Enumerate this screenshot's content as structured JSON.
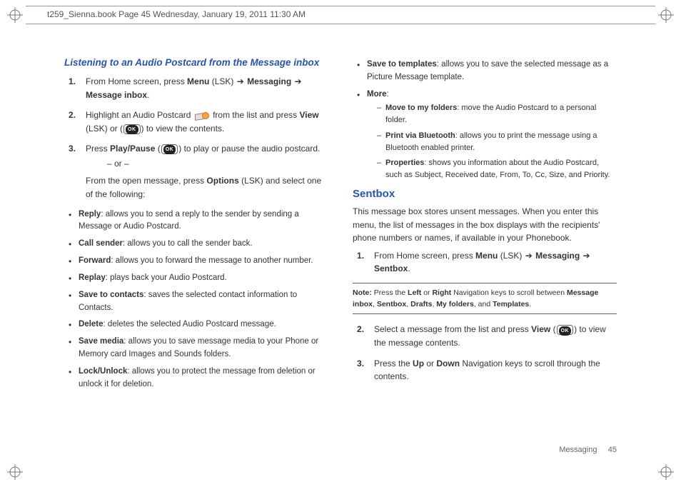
{
  "header": {
    "line": "t259_Sienna.book  Page 45  Wednesday, January 19, 2011  11:30 AM"
  },
  "glyphs": {
    "arrow": "➔",
    "ok": "OK"
  },
  "sect1": {
    "title": "Listening to an Audio Postcard from the Message inbox",
    "steps": {
      "s1": {
        "a": "From Home screen, press ",
        "b": "Menu",
        "c": " (LSK) ",
        "d": " Messaging ",
        "e": " Message inbox",
        "f": "."
      },
      "s2": {
        "a": "Highlight an Audio Postcard ",
        "b": " from the list and press ",
        "c": "View",
        "d": " (LSK) or (",
        "e": ") to view the contents."
      },
      "s3": {
        "a": "Press ",
        "b": "Play/Pause",
        "c": " (",
        "d": ") to play or pause the audio postcard."
      },
      "or": "– or –",
      "s3b": {
        "a": "From the open message, press ",
        "b": "Options",
        "c": " (LSK) and select one of the following:"
      }
    },
    "bul": {
      "reply": {
        "k": "Reply",
        "v": ": allows you to send a reply to the sender by sending a Message or Audio Postcard."
      },
      "call": {
        "k": "Call sender",
        "v": ": allows you to call the sender back."
      },
      "forward": {
        "k": "Forward",
        "v": ": allows you to forward the message to another number."
      },
      "replay": {
        "k": "Replay",
        "v": ": plays back your Audio Postcard."
      },
      "savec": {
        "k": "Save to contacts",
        "v": ": saves the selected contact information to Contacts."
      },
      "delete": {
        "k": "Delete",
        "v": ": deletes the selected Audio Postcard message."
      },
      "savem": {
        "k": "Save media",
        "v": ": allows you to save message media to your Phone or Memory card Images and Sounds folders."
      },
      "lock": {
        "k": "Lock/Unlock",
        "v": ": allows you to protect the message from deletion or unlock it for deletion."
      },
      "savet": {
        "k": "Save to templates",
        "v": ": allows you to save the selected message as a Picture Message template."
      },
      "more": {
        "k": "More",
        "v": ":"
      },
      "more_items": {
        "move": {
          "k": "Move to my folders",
          "v": ": move the Audio Postcard to a personal folder."
        },
        "print": {
          "k": "Print via Bluetooth",
          "v": ": allows you to print the message using a Bluetooth enabled printer."
        },
        "prop": {
          "k": "Properties",
          "v": ": shows you information about the Audio Postcard, such as Subject, Received date, From, To, Cc, Size, and Priority."
        }
      }
    }
  },
  "sentbox": {
    "title": "Sentbox",
    "intro": "This message box stores unsent messages. When you enter this menu, the list of messages in the box displays with the recipients' phone numbers or names, if available in your Phonebook.",
    "steps": {
      "s1": {
        "a": "From Home screen, press ",
        "b": "Menu",
        "c": " (LSK) ",
        "d": " Messaging ",
        "e": " Sentbox",
        "f": "."
      },
      "s2": {
        "a": "Select a message from the list and press ",
        "b": "View",
        "c": " (",
        "d": ") to view the message contents."
      },
      "s3": {
        "a": "Press the ",
        "b": "Up",
        "c": " or ",
        "d": "Down",
        "e": " Navigation keys to scroll through the contents."
      }
    },
    "note": {
      "lead": "Note:",
      "a": " Press the ",
      "b": "Left",
      "c": " or ",
      "d": "Right",
      "e": " Navigation keys to scroll between ",
      "f": "Message inbox",
      "g": ", ",
      "h": "Sentbox",
      "i": ", ",
      "j": "Drafts",
      "k": ", ",
      "l": "My folders",
      "m": ", and ",
      "n": "Templates",
      "o": "."
    }
  },
  "footer": {
    "section": "Messaging",
    "page": "45"
  }
}
